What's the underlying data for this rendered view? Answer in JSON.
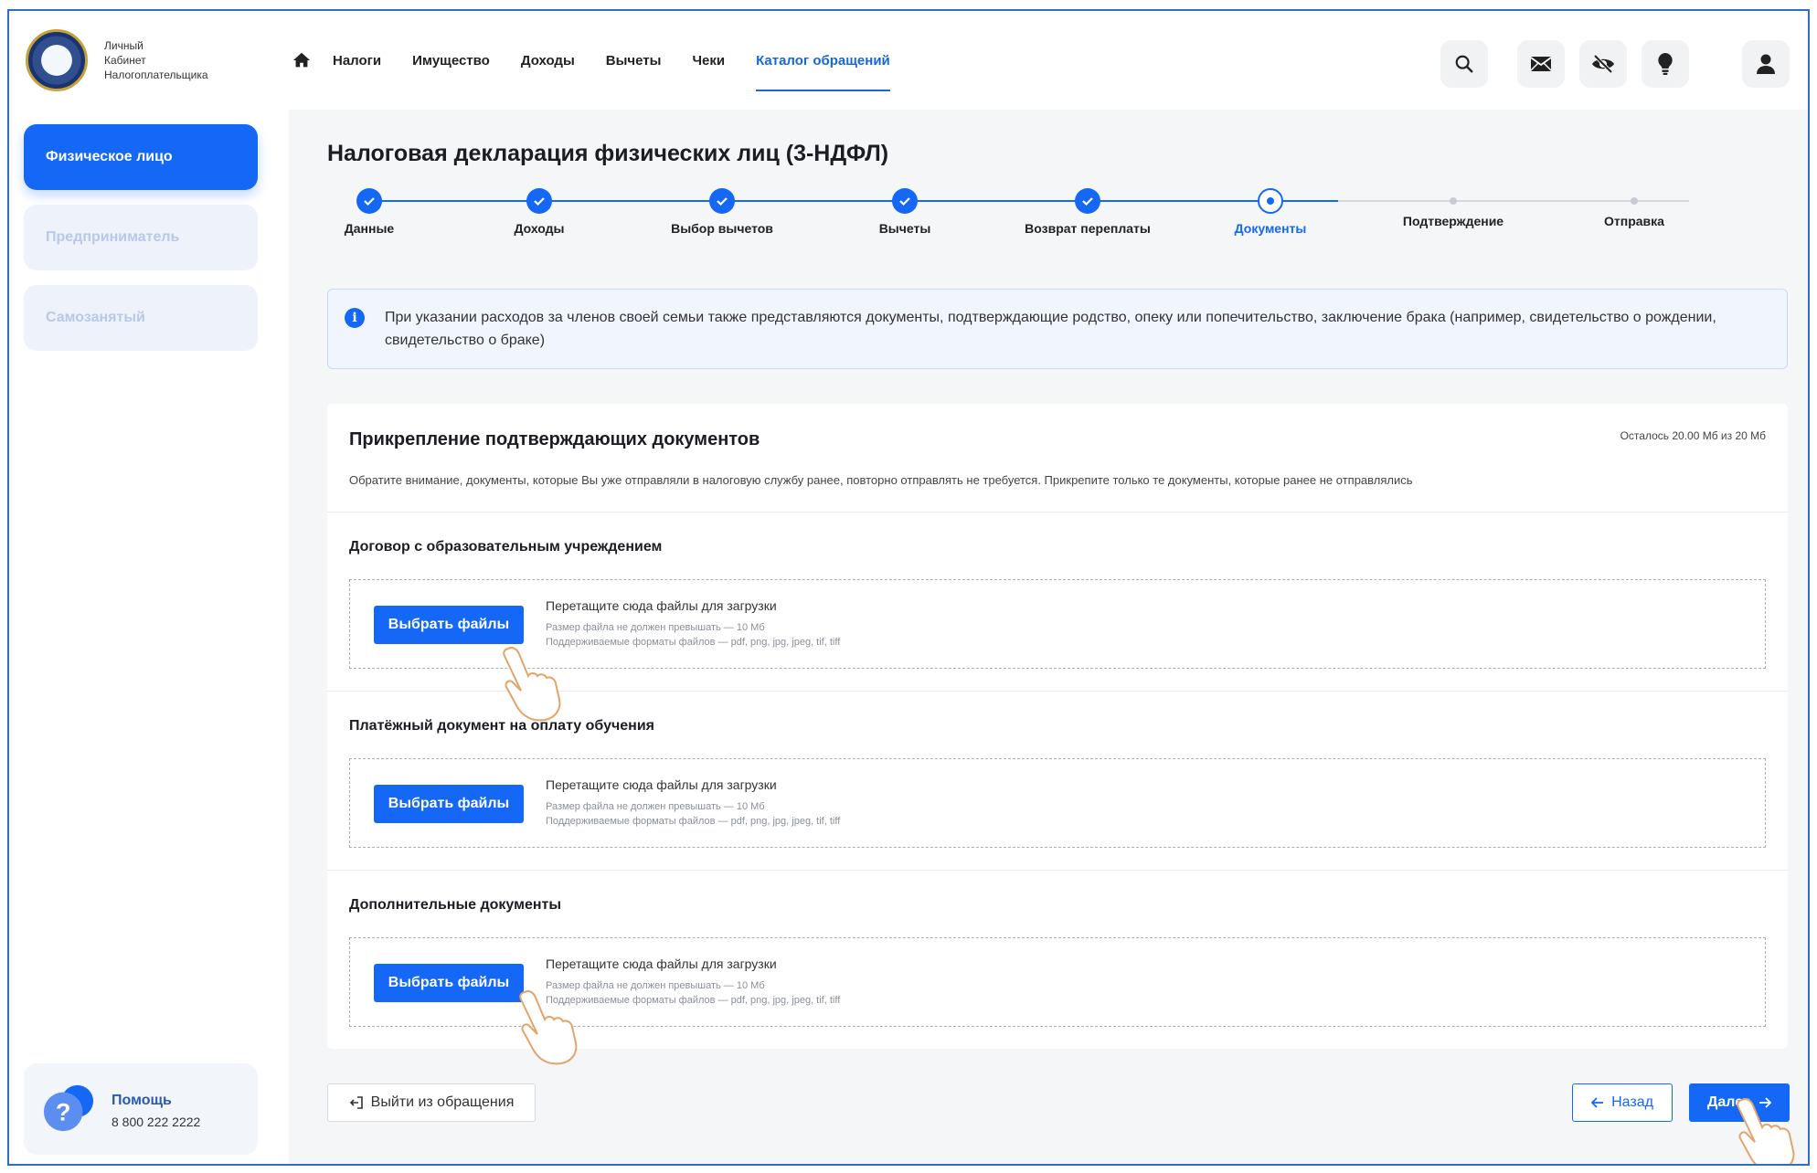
{
  "logo": {
    "line1": "Личный",
    "line2": "Кабинет",
    "line3": "Налогоплательщика"
  },
  "nav": {
    "items": [
      {
        "label": "Налоги"
      },
      {
        "label": "Имущество"
      },
      {
        "label": "Доходы"
      },
      {
        "label": "Вычеты"
      },
      {
        "label": "Чеки"
      },
      {
        "label": "Каталог обращений",
        "active": true
      }
    ]
  },
  "sidebar": {
    "items": [
      {
        "label": "Физическое лицо",
        "active": true
      },
      {
        "label": "Предприниматель"
      },
      {
        "label": "Самозанятый"
      }
    ],
    "help": {
      "title": "Помощь",
      "phone": "8 800 222 2222"
    }
  },
  "page": {
    "title": "Налоговая декларация физических лиц (3-НДФЛ)"
  },
  "stepper": {
    "steps": [
      {
        "label": "Данные",
        "state": "done"
      },
      {
        "label": "Доходы",
        "state": "done"
      },
      {
        "label": "Выбор вычетов",
        "state": "done"
      },
      {
        "label": "Вычеты",
        "state": "done"
      },
      {
        "label": "Возврат переплаты",
        "state": "done"
      },
      {
        "label": "Документы",
        "state": "current"
      },
      {
        "label": "Подтверждение",
        "state": "pending"
      },
      {
        "label": "Отправка",
        "state": "pending"
      }
    ]
  },
  "info": {
    "text": "При указании расходов за членов своей семьи также представляются документы, подтверждающие родство, опеку или попечительство, заключение брака (например, свидетельство о рождении, свидетельство о браке)"
  },
  "attach": {
    "title": "Прикрепление подтверждающих документов",
    "quota": "Осталось 20.00 Мб из 20 Мб",
    "note": "Обратите внимание, документы, которые Вы уже отправляли в налоговую службу ранее, повторно отправлять не требуется. Прикрепите только те документы, которые ранее не отправлялись",
    "sections": [
      {
        "title": "Договор с образовательным учреждением"
      },
      {
        "title": "Платёжный документ на оплату обучения"
      },
      {
        "title": "Дополнительные документы"
      }
    ],
    "drop": {
      "button": "Выбрать файлы",
      "main": "Перетащите сюда файлы для загрузки",
      "size": "Размер файла не должен превышать — 10 Мб",
      "formats": "Поддерживаемые форматы файлов — pdf, png, jpg, jpeg, tif, tiff"
    }
  },
  "buttons": {
    "exit": "Выйти из обращения",
    "back": "Назад",
    "next": "Далее"
  },
  "colors": {
    "accent": "#1468f5",
    "nav_active": "#1767d8"
  }
}
